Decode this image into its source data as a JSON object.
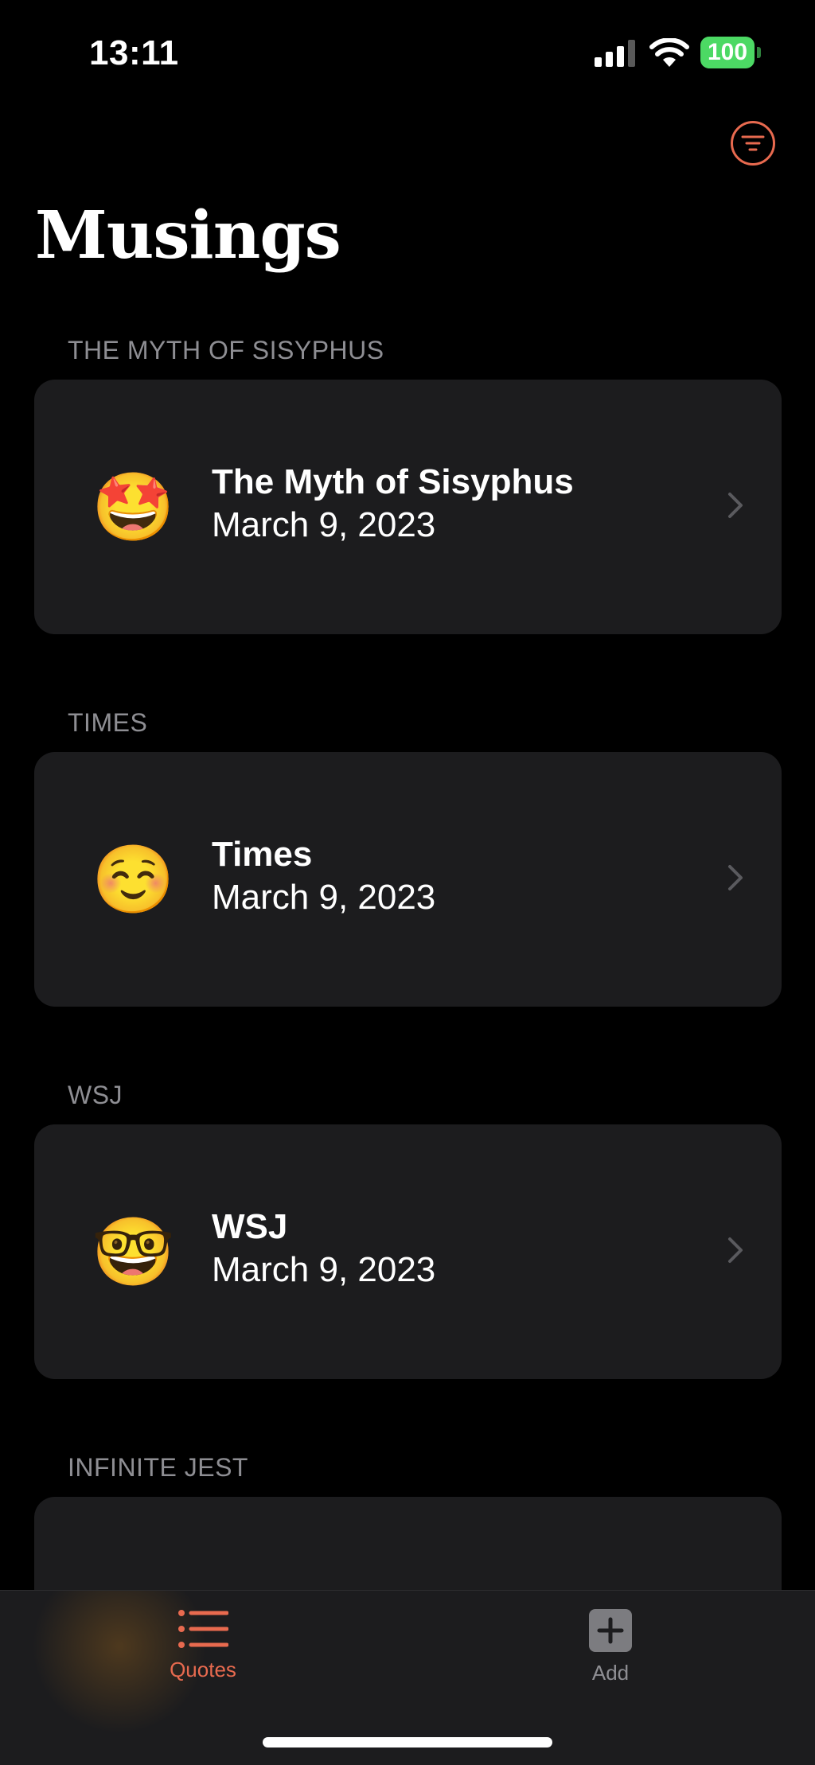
{
  "status_bar": {
    "time": "13:11",
    "battery": "100",
    "signal_icon": "cellular-signal-icon",
    "wifi_icon": "wifi-icon",
    "battery_icon": "battery-icon"
  },
  "header": {
    "title": "Musings",
    "filter_icon": "filter-icon"
  },
  "sections": [
    {
      "header": "THE MYTH OF SISYPHUS",
      "title": "The Myth of Sisyphus",
      "date": "March 9, 2023",
      "emoji": "🤩",
      "emoji_name": "star-struck-emoji-icon"
    },
    {
      "header": "TIMES",
      "title": "Times",
      "date": "March 9, 2023",
      "emoji": "☺️",
      "emoji_name": "smiling-face-emoji-icon"
    },
    {
      "header": "WSJ",
      "title": "WSJ",
      "date": "March 9, 2023",
      "emoji": "🤓",
      "emoji_name": "nerd-face-emoji-icon"
    },
    {
      "header": "INFINITE JEST"
    }
  ],
  "tab_bar": {
    "tabs": [
      {
        "label": "Quotes",
        "icon": "list-icon",
        "selected": true
      },
      {
        "label": "Add",
        "icon": "plus-square-icon",
        "selected": false
      }
    ]
  },
  "colors": {
    "accent": "#e86a4f",
    "background": "#000000",
    "card": "#1c1c1e",
    "secondary_text": "#8e8e93",
    "battery": "#4cd964"
  }
}
